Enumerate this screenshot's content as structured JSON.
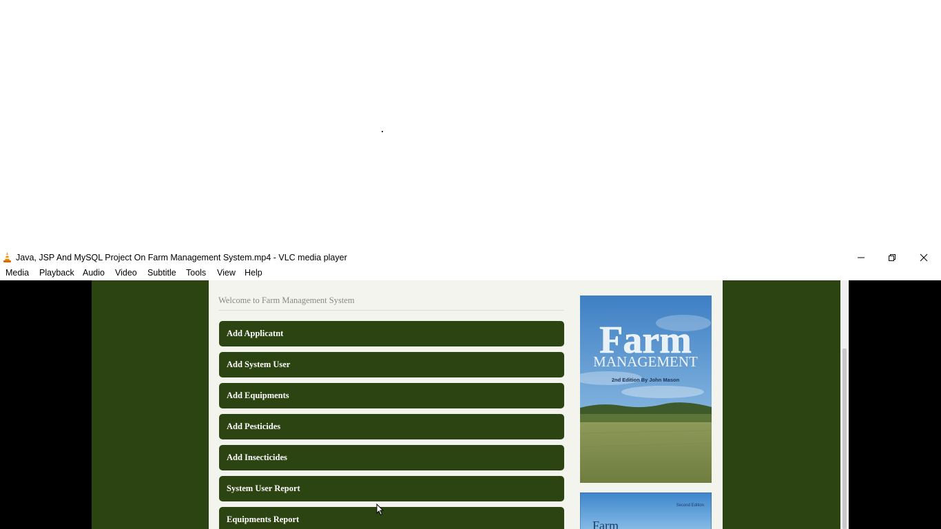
{
  "window": {
    "title": "Java, JSP And MySQL Project On Farm Management System.mp4 - VLC media player"
  },
  "menu": [
    "Media",
    "Playback",
    "Audio",
    "Video",
    "Subtitle",
    "Tools",
    "View",
    "Help"
  ],
  "page": {
    "welcome": "Welcome to Farm Management System",
    "buttons": [
      "Add Applicatnt",
      "Add System User",
      "Add Equipments",
      "Add Pesticides",
      "Add Insecticides",
      "System User Report",
      "Equipments Report"
    ]
  },
  "book": {
    "title_line1": "Farm",
    "title_line2": "MANAGEMENT",
    "edition": "2nd Edition By John Mason",
    "second_title": "Farm",
    "second_edition": "Second Edition"
  },
  "colors": {
    "nav_green": "#2c4312",
    "panel_bg": "#f4f4ee"
  },
  "icons": [
    "vlc-cone-icon",
    "minimize-icon",
    "maximize-icon",
    "close-icon",
    "mouse-cursor-icon"
  ]
}
